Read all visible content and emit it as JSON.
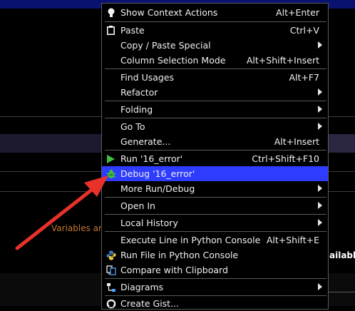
{
  "background": {
    "hint_text": "Variables are",
    "right_text": "ailable"
  },
  "menu": {
    "items": [
      {
        "label": "Show Context Actions",
        "shortcut": "Alt+Enter",
        "icon": "bulb-icon"
      },
      {
        "label": "Paste",
        "shortcut": "Ctrl+V",
        "icon": "clipboard-icon"
      },
      {
        "label": "Copy / Paste Special",
        "submenu": true
      },
      {
        "label": "Column Selection Mode",
        "shortcut": "Alt+Shift+Insert"
      },
      {
        "label": "Find Usages",
        "shortcut": "Alt+F7"
      },
      {
        "label": "Refactor",
        "submenu": true
      },
      {
        "label": "Folding",
        "submenu": true
      },
      {
        "label": "Go To",
        "submenu": true
      },
      {
        "label": "Generate...",
        "shortcut": "Alt+Insert"
      },
      {
        "label": "Run '16_error'",
        "shortcut": "Ctrl+Shift+F10",
        "icon": "run-icon"
      },
      {
        "label": "Debug '16_error'",
        "selected": true,
        "icon": "debug-bug-icon"
      },
      {
        "label": "More Run/Debug",
        "submenu": true
      },
      {
        "label": "Open In",
        "submenu": true
      },
      {
        "label": "Local History",
        "submenu": true
      },
      {
        "label": "Execute Line in Python Console",
        "shortcut": "Alt+Shift+E"
      },
      {
        "label": "Run File in Python Console",
        "icon": "python-icon"
      },
      {
        "label": "Compare with Clipboard",
        "icon": "compare-icon"
      },
      {
        "label": "Diagrams",
        "submenu": true,
        "icon": "diagram-icon"
      },
      {
        "label": "Create Gist...",
        "icon": "github-icon"
      }
    ]
  },
  "colors": {
    "selection": "#2d3cff",
    "annotation_arrow": "#e8312a",
    "run_green": "#3fbf3f"
  }
}
